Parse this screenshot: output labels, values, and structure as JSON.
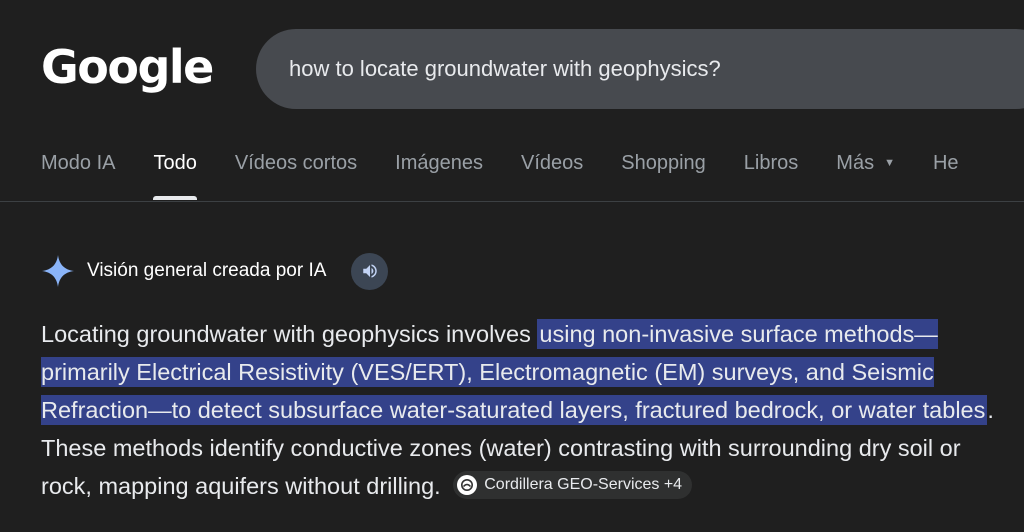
{
  "header": {
    "logo_text": "Google",
    "search": {
      "value": "how to locate groundwater with geophysics?"
    }
  },
  "tabs": [
    {
      "label": "Modo IA",
      "active": false
    },
    {
      "label": "Todo",
      "active": true
    },
    {
      "label": "Vídeos cortos",
      "active": false
    },
    {
      "label": "Imágenes",
      "active": false
    },
    {
      "label": "Vídeos",
      "active": false
    },
    {
      "label": "Shopping",
      "active": false
    },
    {
      "label": "Libros",
      "active": false
    },
    {
      "label": "Más",
      "active": false,
      "has_dropdown": true
    },
    {
      "label": "He",
      "active": false
    }
  ],
  "ai_overview": {
    "title": "Visión general creada por IA",
    "icon": "sparkle-icon",
    "speaker_icon": "speaker-icon",
    "text_before": "Locating groundwater with geophysics involves ",
    "text_highlighted": "using non-invasive surface methods—primarily Electrical Resistivity (VES/ERT), Electromagnetic (EM) surveys, and Seismic Refraction—to detect subsurface water-saturated layers, fractured bedrock, or water tables",
    "text_after": ". These methods identify conductive zones (water) contrasting with surrounding dry soil or rock, mapping aquifers without drilling.",
    "source_chip": "Cordillera GEO-Services +4"
  },
  "colors": {
    "background": "#1f1f1f",
    "search_bg": "#474a4f",
    "highlight": "#34428a",
    "sparkle": "#8ab4f8"
  }
}
